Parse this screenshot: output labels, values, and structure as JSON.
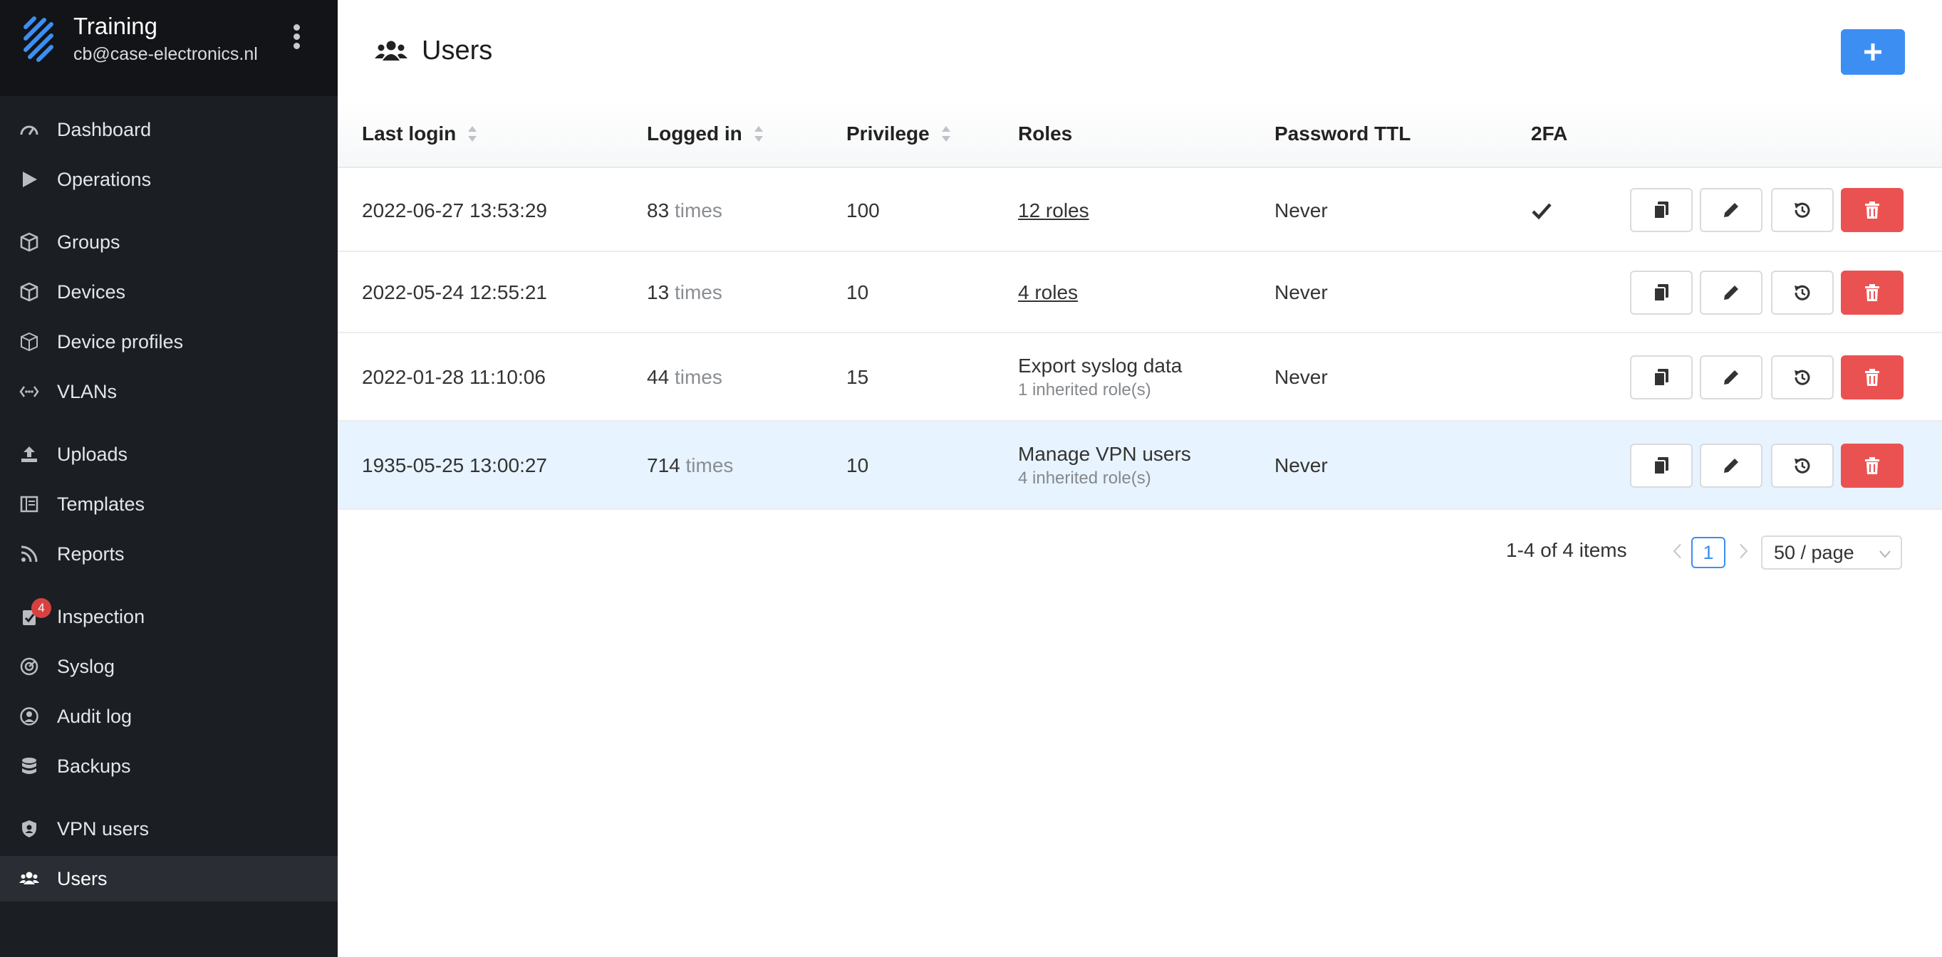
{
  "org": {
    "name": "Training",
    "email": "cb@case-electronics.nl"
  },
  "nav": [
    {
      "label": "Dashboard",
      "icon": "gauge-icon"
    },
    {
      "label": "Operations",
      "icon": "play-icon"
    },
    {
      "label": "Groups",
      "icon": "cubes-icon"
    },
    {
      "label": "Devices",
      "icon": "cube-icon"
    },
    {
      "label": "Device profiles",
      "icon": "cube-outline-icon"
    },
    {
      "label": "VLANs",
      "icon": "network-icon"
    },
    {
      "label": "Uploads",
      "icon": "upload-icon"
    },
    {
      "label": "Templates",
      "icon": "template-icon"
    },
    {
      "label": "Reports",
      "icon": "rss-icon"
    },
    {
      "label": "Inspection",
      "icon": "clipboard-check-icon",
      "badge": "4"
    },
    {
      "label": "Syslog",
      "icon": "radar-icon"
    },
    {
      "label": "Audit log",
      "icon": "user-circle-icon"
    },
    {
      "label": "Backups",
      "icon": "database-icon"
    },
    {
      "label": "VPN users",
      "icon": "shield-user-icon"
    },
    {
      "label": "Users",
      "icon": "users-icon",
      "active": true
    }
  ],
  "page": {
    "title": "Users"
  },
  "table": {
    "columns": {
      "last_login": "Last login",
      "logged_in": "Logged in",
      "privilege": "Privilege",
      "roles": "Roles",
      "password_ttl": "Password TTL",
      "twofa": "2FA"
    },
    "rows": [
      {
        "last_login": "2022-06-27 13:53:29",
        "count": "83",
        "times": "times",
        "privilege": "100",
        "roles": "12 roles",
        "roles_link": true,
        "inherited": "",
        "password_ttl": "Never",
        "twofa": true
      },
      {
        "last_login": "2022-05-24 12:55:21",
        "count": "13",
        "times": "times",
        "privilege": "10",
        "roles": "4 roles",
        "roles_link": true,
        "inherited": "",
        "password_ttl": "Never",
        "twofa": false
      },
      {
        "last_login": "2022-01-28 11:10:06",
        "count": "44",
        "times": "times",
        "privilege": "15",
        "roles": "Export syslog data",
        "roles_link": false,
        "inherited": "1 inherited role(s)",
        "password_ttl": "Never",
        "twofa": false
      },
      {
        "last_login": "1935-05-25 13:00:27",
        "count": "714",
        "times": "times",
        "privilege": "10",
        "roles": "Manage VPN users",
        "roles_link": false,
        "inherited": "4 inherited role(s)",
        "password_ttl": "Never",
        "twofa": false,
        "highlight": true
      }
    ]
  },
  "pagination": {
    "summary": "1-4 of 4 items",
    "current_page": "1",
    "page_size": "50 / page"
  },
  "colors": {
    "accent": "#3d8ef3",
    "danger": "#ea5252",
    "sidebar": "#1b1e22",
    "row_highlight": "#e7f3fe"
  }
}
